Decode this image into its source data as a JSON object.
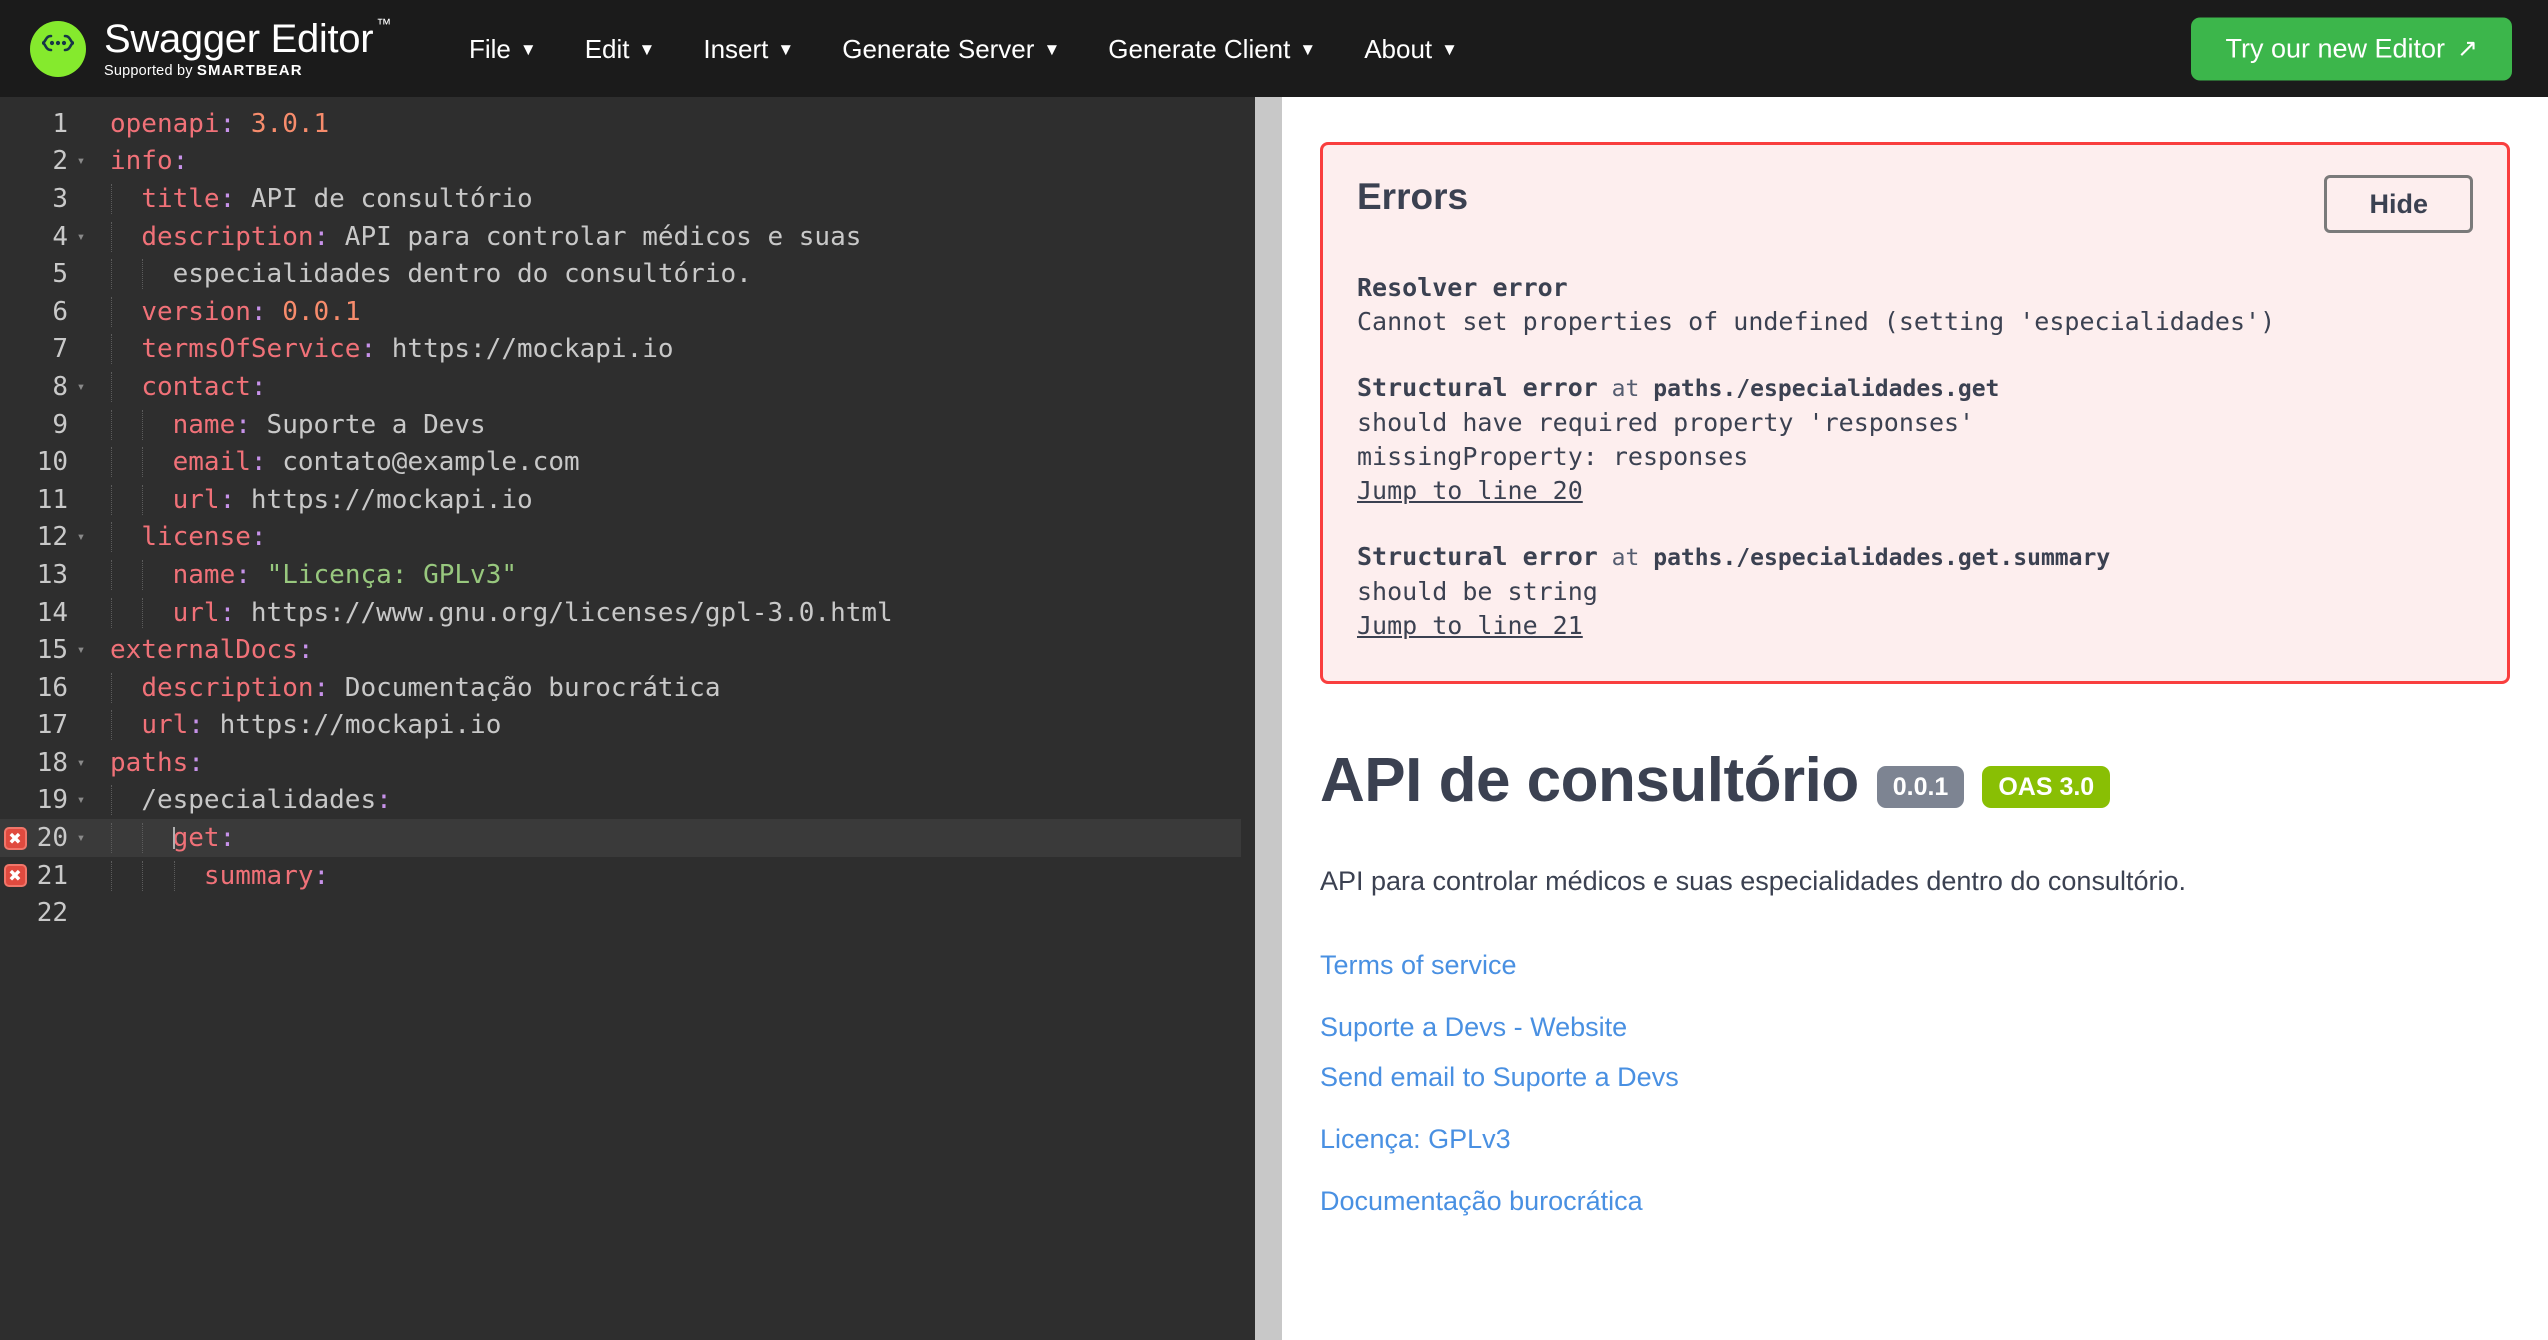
{
  "app": {
    "brand_title": "Swagger Editor",
    "brand_tm": "™",
    "brand_supported_prefix": "Supported by ",
    "brand_supported_company": "SMARTBEAR"
  },
  "menu": {
    "items": [
      {
        "label": "File",
        "caret": "▼"
      },
      {
        "label": "Edit",
        "caret": "▼"
      },
      {
        "label": "Insert",
        "caret": "▼"
      },
      {
        "label": "Generate Server",
        "caret": "▼"
      },
      {
        "label": "Generate Client",
        "caret": "▼"
      },
      {
        "label": "About",
        "caret": "▼"
      }
    ],
    "try_editor_label": "Try our new Editor",
    "try_editor_arrow": "↗"
  },
  "editor": {
    "lines": [
      {
        "n": "1",
        "fold": "",
        "error": false,
        "active": false,
        "indent": 0,
        "segments": [
          {
            "t": "key",
            "v": "openapi"
          },
          {
            "t": "colon",
            "v": ":"
          },
          {
            "t": "val",
            "v": " "
          },
          {
            "t": "num",
            "v": "3.0.1"
          }
        ]
      },
      {
        "n": "2",
        "fold": "▾",
        "error": false,
        "active": false,
        "indent": 0,
        "segments": [
          {
            "t": "key",
            "v": "info"
          },
          {
            "t": "colon",
            "v": ":"
          }
        ]
      },
      {
        "n": "3",
        "fold": "",
        "error": false,
        "active": false,
        "indent": 1,
        "segments": [
          {
            "t": "val",
            "v": "  "
          },
          {
            "t": "key",
            "v": "title"
          },
          {
            "t": "colon",
            "v": ":"
          },
          {
            "t": "val",
            "v": " API de consultório"
          }
        ]
      },
      {
        "n": "4",
        "fold": "▾",
        "error": false,
        "active": false,
        "indent": 1,
        "segments": [
          {
            "t": "val",
            "v": "  "
          },
          {
            "t": "key",
            "v": "description"
          },
          {
            "t": "colon",
            "v": ":"
          },
          {
            "t": "val",
            "v": " API para controlar médicos e suas"
          }
        ]
      },
      {
        "n": "5",
        "fold": "",
        "error": false,
        "active": false,
        "indent": 2,
        "segments": [
          {
            "t": "val",
            "v": "    especialidades dentro do consultório."
          }
        ]
      },
      {
        "n": "6",
        "fold": "",
        "error": false,
        "active": false,
        "indent": 1,
        "segments": [
          {
            "t": "val",
            "v": "  "
          },
          {
            "t": "key",
            "v": "version"
          },
          {
            "t": "colon",
            "v": ":"
          },
          {
            "t": "val",
            "v": " "
          },
          {
            "t": "num",
            "v": "0.0.1"
          }
        ]
      },
      {
        "n": "7",
        "fold": "",
        "error": false,
        "active": false,
        "indent": 1,
        "segments": [
          {
            "t": "val",
            "v": "  "
          },
          {
            "t": "key",
            "v": "termsOfService"
          },
          {
            "t": "colon",
            "v": ":"
          },
          {
            "t": "val",
            "v": " https://mockapi.io"
          }
        ]
      },
      {
        "n": "8",
        "fold": "▾",
        "error": false,
        "active": false,
        "indent": 1,
        "segments": [
          {
            "t": "val",
            "v": "  "
          },
          {
            "t": "key",
            "v": "contact"
          },
          {
            "t": "colon",
            "v": ":"
          }
        ]
      },
      {
        "n": "9",
        "fold": "",
        "error": false,
        "active": false,
        "indent": 2,
        "segments": [
          {
            "t": "val",
            "v": "    "
          },
          {
            "t": "key",
            "v": "name"
          },
          {
            "t": "colon",
            "v": ":"
          },
          {
            "t": "val",
            "v": " Suporte a Devs"
          }
        ]
      },
      {
        "n": "10",
        "fold": "",
        "error": false,
        "active": false,
        "indent": 2,
        "segments": [
          {
            "t": "val",
            "v": "    "
          },
          {
            "t": "key",
            "v": "email"
          },
          {
            "t": "colon",
            "v": ":"
          },
          {
            "t": "val",
            "v": " contato@example.com"
          }
        ]
      },
      {
        "n": "11",
        "fold": "",
        "error": false,
        "active": false,
        "indent": 2,
        "segments": [
          {
            "t": "val",
            "v": "    "
          },
          {
            "t": "key",
            "v": "url"
          },
          {
            "t": "colon",
            "v": ":"
          },
          {
            "t": "val",
            "v": " https://mockapi.io"
          }
        ]
      },
      {
        "n": "12",
        "fold": "▾",
        "error": false,
        "active": false,
        "indent": 1,
        "segments": [
          {
            "t": "val",
            "v": "  "
          },
          {
            "t": "key",
            "v": "license"
          },
          {
            "t": "colon",
            "v": ":"
          }
        ]
      },
      {
        "n": "13",
        "fold": "",
        "error": false,
        "active": false,
        "indent": 2,
        "segments": [
          {
            "t": "val",
            "v": "    "
          },
          {
            "t": "key",
            "v": "name"
          },
          {
            "t": "colon",
            "v": ":"
          },
          {
            "t": "val",
            "v": " "
          },
          {
            "t": "str",
            "v": "\"Licença: GPLv3\""
          }
        ]
      },
      {
        "n": "14",
        "fold": "",
        "error": false,
        "active": false,
        "indent": 2,
        "segments": [
          {
            "t": "val",
            "v": "    "
          },
          {
            "t": "key",
            "v": "url"
          },
          {
            "t": "colon",
            "v": ":"
          },
          {
            "t": "val",
            "v": " https://www.gnu.org/licenses/gpl-3.0.html"
          }
        ]
      },
      {
        "n": "15",
        "fold": "▾",
        "error": false,
        "active": false,
        "indent": 0,
        "segments": [
          {
            "t": "key",
            "v": "externalDocs"
          },
          {
            "t": "colon",
            "v": ":"
          }
        ]
      },
      {
        "n": "16",
        "fold": "",
        "error": false,
        "active": false,
        "indent": 1,
        "segments": [
          {
            "t": "val",
            "v": "  "
          },
          {
            "t": "key",
            "v": "description"
          },
          {
            "t": "colon",
            "v": ":"
          },
          {
            "t": "val",
            "v": " Documentação burocrática"
          }
        ]
      },
      {
        "n": "17",
        "fold": "",
        "error": false,
        "active": false,
        "indent": 1,
        "segments": [
          {
            "t": "val",
            "v": "  "
          },
          {
            "t": "key",
            "v": "url"
          },
          {
            "t": "colon",
            "v": ":"
          },
          {
            "t": "val",
            "v": " https://mockapi.io"
          }
        ]
      },
      {
        "n": "18",
        "fold": "▾",
        "error": false,
        "active": false,
        "indent": 0,
        "segments": [
          {
            "t": "key",
            "v": "paths"
          },
          {
            "t": "colon",
            "v": ":"
          }
        ]
      },
      {
        "n": "19",
        "fold": "▾",
        "error": false,
        "active": false,
        "indent": 1,
        "segments": [
          {
            "t": "val",
            "v": "  "
          },
          {
            "t": "val",
            "v": "/especialidades"
          },
          {
            "t": "colon",
            "v": ":"
          }
        ]
      },
      {
        "n": "20",
        "fold": "▾",
        "error": true,
        "active": true,
        "indent": 2,
        "segments": [
          {
            "t": "val",
            "v": "    "
          },
          {
            "t": "key",
            "v": "get"
          },
          {
            "t": "colon",
            "v": ":"
          }
        ]
      },
      {
        "n": "21",
        "fold": "",
        "error": true,
        "active": false,
        "indent": 3,
        "segments": [
          {
            "t": "val",
            "v": "      "
          },
          {
            "t": "key",
            "v": "summary"
          },
          {
            "t": "colon",
            "v": ":"
          }
        ]
      },
      {
        "n": "22",
        "fold": "",
        "error": false,
        "active": false,
        "indent": 0,
        "segments": []
      }
    ]
  },
  "errors": {
    "title": "Errors",
    "hide_label": "Hide",
    "items": [
      {
        "kind": "Resolver error",
        "at_prefix": "",
        "location": "",
        "detail_lines": [
          "Cannot set properties of undefined (setting 'especialidades')"
        ],
        "jump_label": ""
      },
      {
        "kind": "Structural error",
        "at_prefix": " at ",
        "location": "paths./especialidades.get",
        "detail_lines": [
          "should have required property 'responses'",
          "missingProperty: responses"
        ],
        "jump_label": "Jump to line 20"
      },
      {
        "kind": "Structural error",
        "at_prefix": " at ",
        "location": "paths./especialidades.get.summary",
        "detail_lines": [
          "should be string"
        ],
        "jump_label": "Jump to line 21"
      }
    ]
  },
  "api_info": {
    "title": "API de consultório",
    "version_badge": "0.0.1",
    "oas_badge": "OAS 3.0",
    "description": "API para controlar médicos e suas especialidades dentro do consultório.",
    "links": [
      {
        "label": "Terms of service",
        "spaced": false
      },
      {
        "label": "Suporte a Devs - Website",
        "spaced": true
      },
      {
        "label": "Send email to Suporte a Devs",
        "spaced": false
      },
      {
        "label": "Licença: GPLv3",
        "spaced": true
      },
      {
        "label": "Documentação burocrática",
        "spaced": true
      }
    ]
  },
  "colors": {
    "accent_green": "#85ea2d",
    "try_button": "#3cb64b",
    "error_border": "#f93e3e",
    "error_bg": "#fdeeee",
    "link_blue": "#4990e2",
    "badge_gray": "#7d8492",
    "badge_oas": "#89bf04",
    "editor_bg": "#2e2e2e",
    "topbar_bg": "#1b1b1b"
  }
}
